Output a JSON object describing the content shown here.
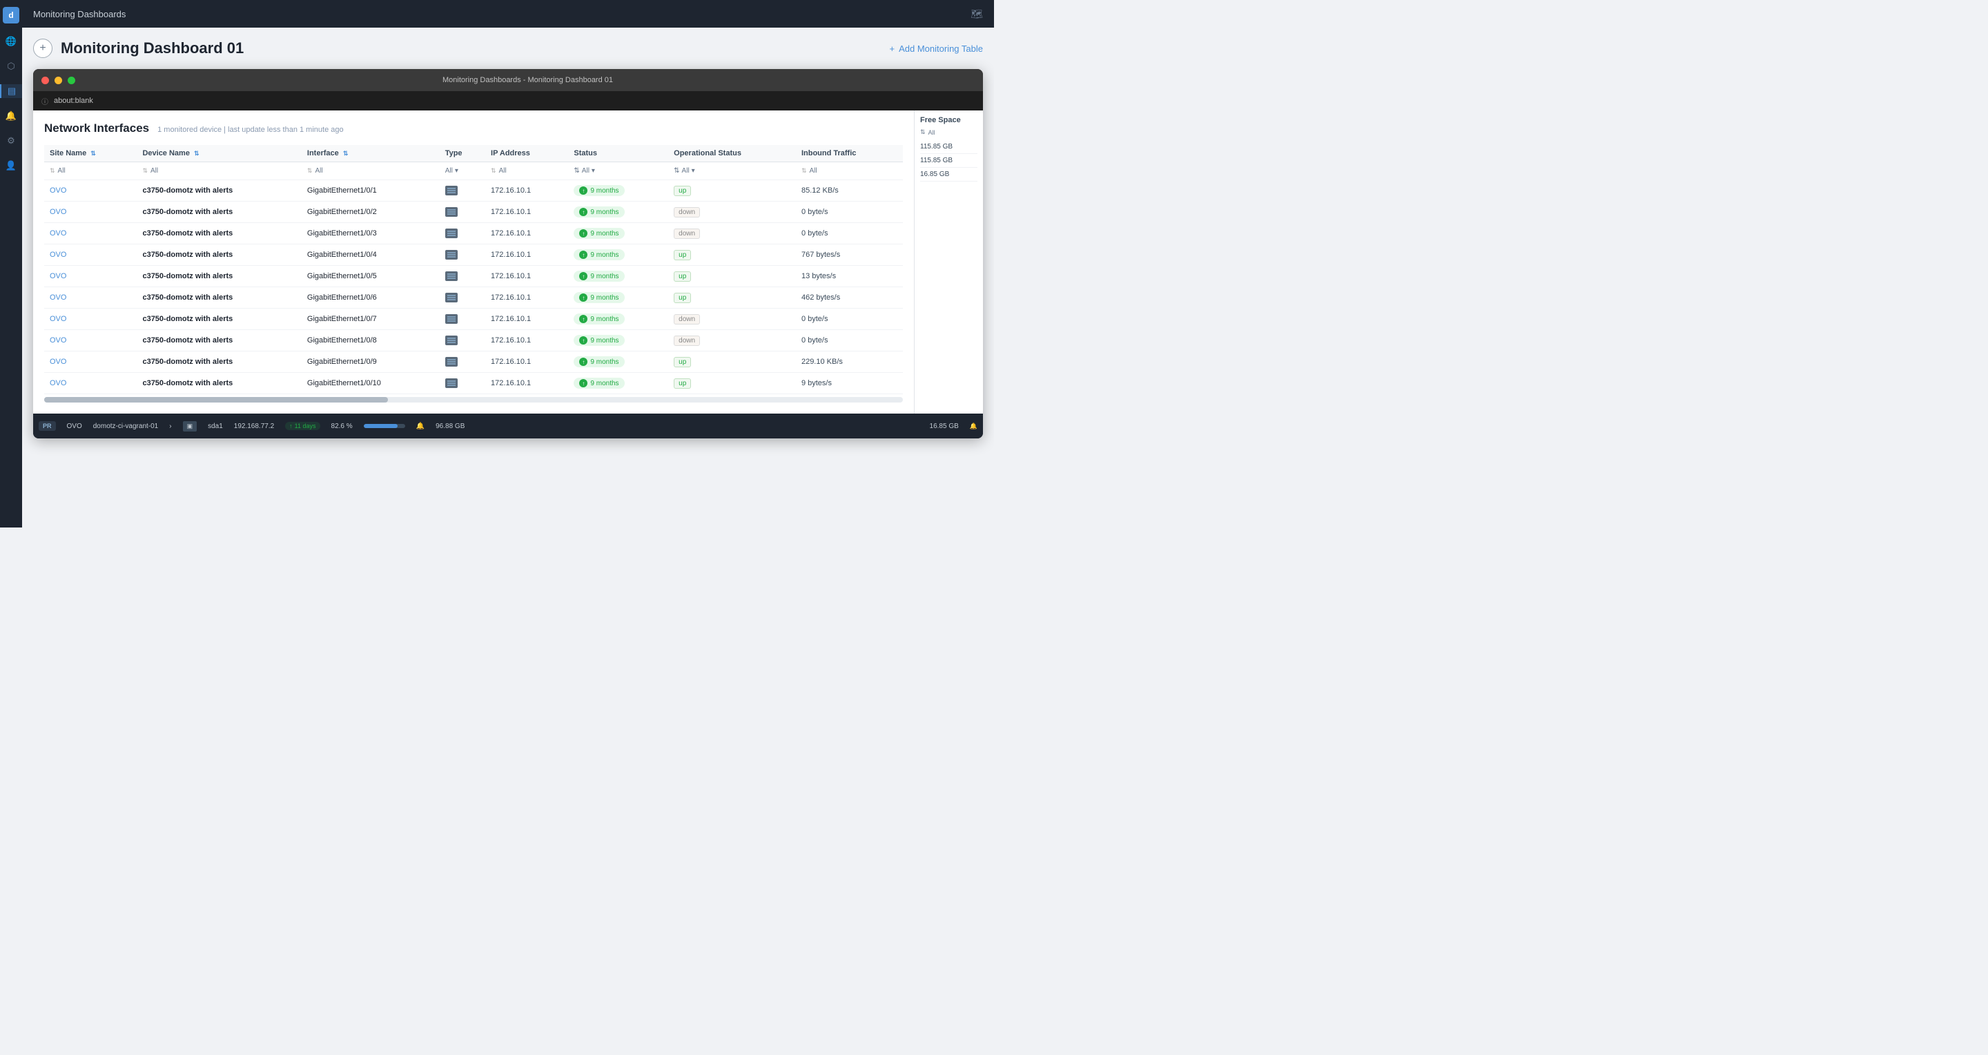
{
  "app": {
    "title": "Monitoring Dashboards",
    "logo": "d",
    "page_title": "Monitoring Dashboard 01",
    "add_monitoring_label": "Add Monitoring Table"
  },
  "browser": {
    "window_title": "Monitoring Dashboards - Monitoring Dashboard 01",
    "url": "about:blank"
  },
  "table": {
    "heading": "Network Interfaces",
    "subtext": "1 monitored device | last update less than 1 minute ago",
    "columns": [
      "Site Name",
      "Device Name",
      "Interface",
      "Type",
      "IP Address",
      "Status",
      "Operational Status",
      "Inbound Traffic"
    ],
    "filter_placeholder": "All",
    "rows": [
      {
        "site": "OVO",
        "device": "c3750-domotz with alerts",
        "interface": "GigabitEthernet1/0/1",
        "ip": "172.16.10.1",
        "status_months": "9 months",
        "op_status": "up",
        "traffic": "85.12 KB/s"
      },
      {
        "site": "OVO",
        "device": "c3750-domotz with alerts",
        "interface": "GigabitEthernet1/0/2",
        "ip": "172.16.10.1",
        "status_months": "9 months",
        "op_status": "down",
        "traffic": "0 byte/s"
      },
      {
        "site": "OVO",
        "device": "c3750-domotz with alerts",
        "interface": "GigabitEthernet1/0/3",
        "ip": "172.16.10.1",
        "status_months": "9 months",
        "op_status": "down",
        "traffic": "0 byte/s"
      },
      {
        "site": "OVO",
        "device": "c3750-domotz with alerts",
        "interface": "GigabitEthernet1/0/4",
        "ip": "172.16.10.1",
        "status_months": "9 months",
        "op_status": "up",
        "traffic": "767 bytes/s"
      },
      {
        "site": "OVO",
        "device": "c3750-domotz with alerts",
        "interface": "GigabitEthernet1/0/5",
        "ip": "172.16.10.1",
        "status_months": "9 months",
        "op_status": "up",
        "traffic": "13 bytes/s"
      },
      {
        "site": "OVO",
        "device": "c3750-domotz with alerts",
        "interface": "GigabitEthernet1/0/6",
        "ip": "172.16.10.1",
        "status_months": "9 months",
        "op_status": "up",
        "traffic": "462 bytes/s"
      },
      {
        "site": "OVO",
        "device": "c3750-domotz with alerts",
        "interface": "GigabitEthernet1/0/7",
        "ip": "172.16.10.1",
        "status_months": "9 months",
        "op_status": "down",
        "traffic": "0 byte/s"
      },
      {
        "site": "OVO",
        "device": "c3750-domotz with alerts",
        "interface": "GigabitEthernet1/0/8",
        "ip": "172.16.10.1",
        "status_months": "9 months",
        "op_status": "down",
        "traffic": "0 byte/s"
      },
      {
        "site": "OVO",
        "device": "c3750-domotz with alerts",
        "interface": "GigabitEthernet1/0/9",
        "ip": "172.16.10.1",
        "status_months": "9 months",
        "op_status": "up",
        "traffic": "229.10 KB/s"
      },
      {
        "site": "OVO",
        "device": "c3750-domotz with alerts",
        "interface": "GigabitEthernet1/0/10",
        "ip": "172.16.10.1",
        "status_months": "9 months",
        "op_status": "up",
        "traffic": "9 bytes/s"
      }
    ]
  },
  "right_panel": {
    "header": "Free Space",
    "filter": "All",
    "values": [
      "115.85 GB",
      "115.85 GB",
      "16.85 GB"
    ]
  },
  "bottom_bar": {
    "tag": "PR",
    "site": "OVO",
    "device": "domotz-ci-vagrant-01",
    "arrow": "›",
    "disk": "sda1",
    "ip": "192.168.77.2",
    "days_badge": "11 days",
    "percent": "82.6 %",
    "progress": 82.6,
    "alert_icon": "🔔",
    "free_space": "96.88 GB",
    "right_free": "16.85 GB"
  },
  "sidebar": {
    "icons": [
      "🌐",
      "⬡",
      "📊",
      "🔔",
      "🔧",
      "👤"
    ]
  }
}
